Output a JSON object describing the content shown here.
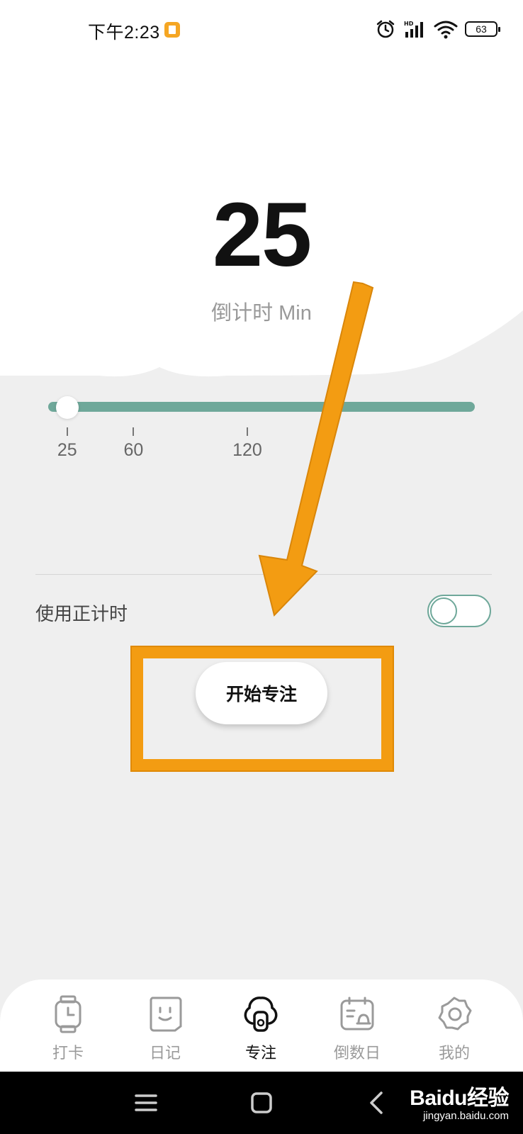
{
  "status_bar": {
    "time": "下午2:23",
    "app_icon": "orange-app-notification-icon",
    "icons": [
      "alarm-icon",
      "signal-hd-icon",
      "wifi-icon"
    ],
    "battery": "63"
  },
  "timer": {
    "value": "25",
    "caption": "倒计时 Min"
  },
  "slider": {
    "current_value": 25,
    "min": 15,
    "max": 240,
    "ticks": [
      "25",
      "60",
      "120"
    ],
    "tick_values": [
      25,
      60,
      120
    ]
  },
  "options": {
    "count_up_label": "使用正计时",
    "count_up_enabled": false
  },
  "start_button_label": "开始专注",
  "tabs": [
    {
      "label": "打卡",
      "icon": "watch-icon",
      "active": false
    },
    {
      "label": "日记",
      "icon": "diary-face-icon",
      "active": false
    },
    {
      "label": "专注",
      "icon": "focus-timer-icon",
      "active": true
    },
    {
      "label": "倒数日",
      "icon": "countdown-calendar-icon",
      "active": false
    },
    {
      "label": "我的",
      "icon": "settings-gear-icon",
      "active": false
    }
  ],
  "watermark": {
    "main": "Baidu经验",
    "sub": "jingyan.baidu.com"
  },
  "colors": {
    "accent": "#6fa89a",
    "annotation": "#f39c12",
    "background": "#efefef"
  }
}
